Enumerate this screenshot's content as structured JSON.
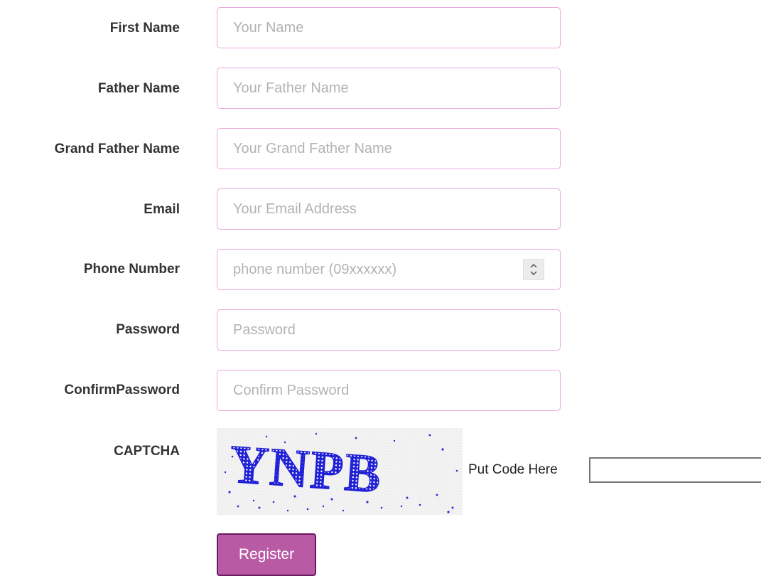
{
  "form": {
    "fields": [
      {
        "label": "First Name",
        "placeholder": "Your Name",
        "value": ""
      },
      {
        "label": "Father Name",
        "placeholder": "Your Father Name",
        "value": ""
      },
      {
        "label": "Grand Father Name",
        "placeholder": "Your Grand Father Name",
        "value": ""
      },
      {
        "label": "Email",
        "placeholder": "Your Email Address",
        "value": ""
      },
      {
        "label": "Phone Number",
        "placeholder": "phone number (09xxxxxx)",
        "value": ""
      },
      {
        "label": "Password",
        "placeholder": "Password",
        "value": ""
      },
      {
        "label": "ConfirmPassword",
        "placeholder": "Confirm Password",
        "value": ""
      }
    ],
    "captcha": {
      "label": "CAPTCHA",
      "image_text": "YNPB",
      "code_label": "Put Code Here",
      "code_value": ""
    },
    "register_label": "Register"
  },
  "colors": {
    "field_border": "#e9a7dd",
    "button_bg": "#b95aa5",
    "button_border": "#6b1c5f",
    "captcha_text": "#1f1fd6"
  },
  "icons": {
    "phone_spinner": "updown-chevron-icon"
  }
}
